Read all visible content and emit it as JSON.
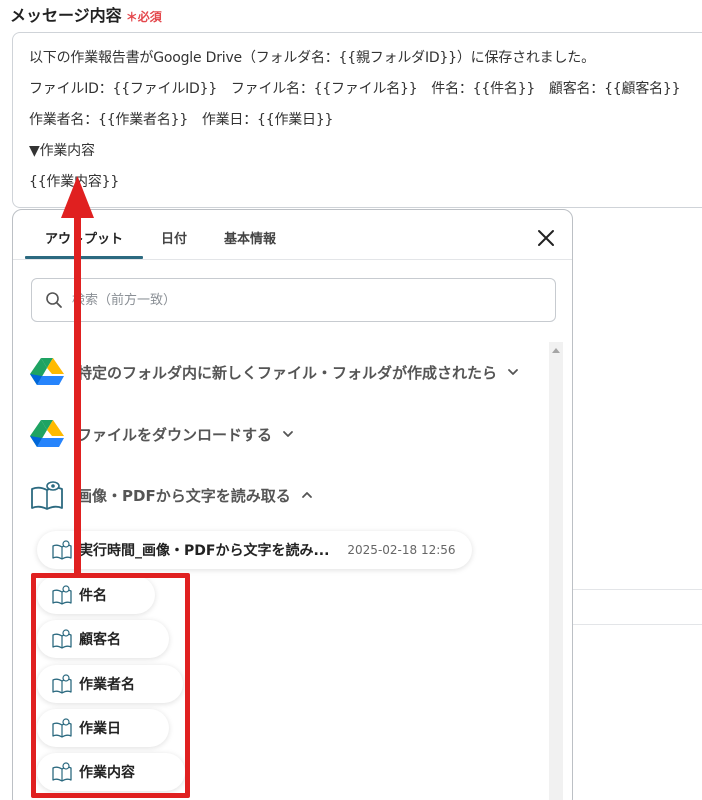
{
  "field": {
    "label": "メッセージ内容",
    "required_mark": "＊",
    "required_text": "必須"
  },
  "message": {
    "lines": [
      "以下の作業報告書がGoogle Drive（フォルダ名：{{親フォルダID}}）に保存されました。",
      "ファイルID：{{ファイルID}}　ファイル名：{{ファイル名}}　件名：{{件名}}　顧客名：{{顧客名}}",
      "作業者名：{{作業者名}}　作業日：{{作業日}}",
      "▼作業内容",
      "{{作業内容}}"
    ]
  },
  "panel": {
    "tabs": [
      {
        "label": "アウトプット"
      },
      {
        "label": "日付"
      },
      {
        "label": "基本情報"
      }
    ],
    "active_tab": 0,
    "close_icon": "close-icon",
    "search": {
      "placeholder": "検索（前方一致）",
      "value": ""
    },
    "groups": [
      {
        "label": "特定のフォルダ内に新しくファイル・フォルダが作成されたら",
        "icon": "google-drive-icon",
        "expanded": false
      },
      {
        "label": "ファイルをダウンロードする",
        "icon": "google-drive-icon",
        "expanded": false
      },
      {
        "label": "画像・PDFから文字を読み取る",
        "icon": "ocr-book-eye-icon",
        "expanded": true
      }
    ],
    "outputs": [
      {
        "label": "実行時間_画像・PDFから文字を読み...",
        "date": "2025-02-18 12:56"
      },
      {
        "label": "件名"
      },
      {
        "label": "顧客名"
      },
      {
        "label": "作業者名"
      },
      {
        "label": "作業日"
      },
      {
        "label": "作業内容"
      }
    ]
  },
  "colors": {
    "accent": "#2c6a80",
    "required": "#e4484d",
    "annotation": "#e02020",
    "drive_green": "#1ea362",
    "drive_yellow": "#ffba00",
    "drive_blue": "#2684fc"
  }
}
